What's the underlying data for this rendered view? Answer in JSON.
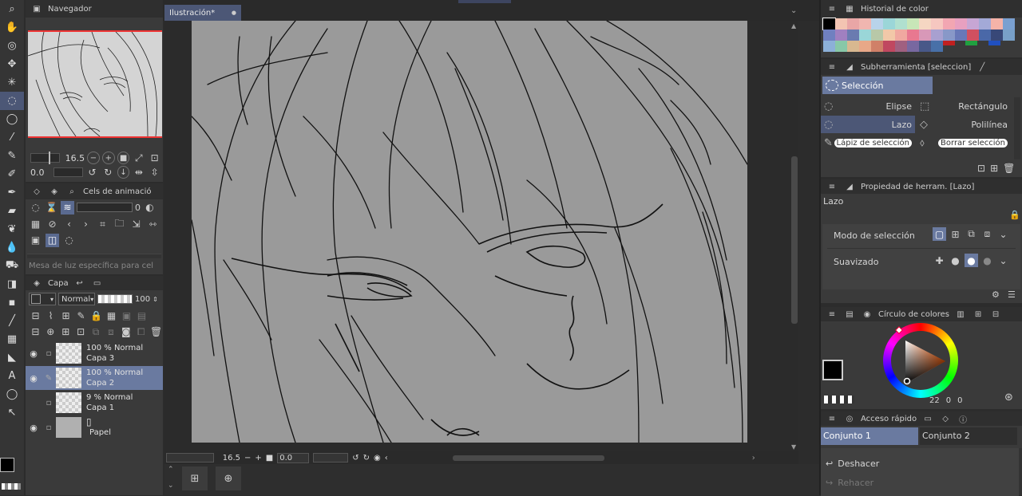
{
  "navigator": {
    "title": "Navegador",
    "zoom": "16.5",
    "rotation": "0.0"
  },
  "document_tab": {
    "label": "Ilustración*",
    "dot": "●"
  },
  "tools": [
    {
      "name": "zoom-tool",
      "icon": "⌕"
    },
    {
      "name": "hand-tool",
      "icon": "✋"
    },
    {
      "name": "rotate-tool",
      "icon": "◎"
    },
    {
      "name": "move-tool",
      "icon": "✥"
    },
    {
      "name": "auto-select-tool",
      "icon": "✳"
    },
    {
      "name": "lasso-tool",
      "icon": "◌"
    },
    {
      "name": "selection-tool",
      "icon": "◯"
    },
    {
      "name": "eyedropper-tool",
      "icon": "⁄"
    },
    {
      "name": "pen-tool",
      "icon": "✎"
    },
    {
      "name": "pencil-tool",
      "icon": "✐"
    },
    {
      "name": "brush-tool",
      "icon": "✒"
    },
    {
      "name": "eraser-tool",
      "icon": "▰"
    },
    {
      "name": "decoration-tool",
      "icon": "❦"
    },
    {
      "name": "blend-tool",
      "icon": "💧"
    },
    {
      "name": "fill-tool",
      "icon": "⛟"
    },
    {
      "name": "gradient-tool",
      "icon": "◨"
    },
    {
      "name": "shape-tool",
      "icon": "▪"
    },
    {
      "name": "line-tool",
      "icon": "╱"
    },
    {
      "name": "frame-tool",
      "icon": "▦"
    },
    {
      "name": "vector-tool",
      "icon": "◣"
    },
    {
      "name": "text-tool",
      "icon": "A"
    },
    {
      "name": "balloon-tool",
      "icon": "◯"
    },
    {
      "name": "correct-line-tool",
      "icon": "↖"
    }
  ],
  "animation_panel": {
    "title": "Cels de animació",
    "value": "0",
    "lightbox_label": "Mesa de luz específica para cel"
  },
  "layer_panel": {
    "tab": "Capa",
    "blend_mode": "Normal",
    "opacity": "100",
    "layers": [
      {
        "line1": "100 % Normal",
        "line2": "Capa 3",
        "selected": false
      },
      {
        "line1": "100 % Normal",
        "line2": "Capa 2",
        "selected": true
      },
      {
        "line1": "9 % Normal",
        "line2": "Capa 1",
        "selected": false
      },
      {
        "line1": "",
        "line2": "Papel",
        "selected": false
      }
    ]
  },
  "canvas_bottom": {
    "zoom": "16.5",
    "rotation": "0.0"
  },
  "color_history": {
    "title": "Historial de color",
    "swatches": [
      "#000000",
      "#f3c4b2",
      "#e9a6a6",
      "#f0b6b0",
      "#b8d3ea",
      "#9bd6d8",
      "#b0e0cf",
      "#c8e6b8",
      "#f5d6c2",
      "#f6c7c0",
      "#f2a6b2",
      "#e8a0c0",
      "#c7a6d4",
      "#a3a9d7",
      "#f5b3a8",
      "#7aa0d0",
      "#7080c0",
      "#a080c0",
      "#6a7bb0",
      "#9ad6d8",
      "#b8c8a8",
      "#f2c8a8",
      "#f0a8a0",
      "#e87890",
      "#d898b8",
      "#a8a0d0",
      "#8898c8",
      "#6878b8",
      "#d05060",
      "#4a68a8",
      "#384878",
      "#78a0c8",
      "#8cb0d8",
      "#88c8a8",
      "#d8b890",
      "#e8a888",
      "#d08068",
      "#c04860",
      "#a06080",
      "#7868a0",
      "#485888",
      "#4870a8",
      "#c02020",
      "#20a040",
      "#2050c0"
    ]
  },
  "subtool": {
    "title": "Subherramienta [seleccion]",
    "group": "Selección",
    "items": [
      {
        "label": "Elipse",
        "icon": "◌"
      },
      {
        "label": "Rectángulo",
        "icon": "⬚"
      },
      {
        "label": "Lazo",
        "icon": "◌",
        "selected": true
      },
      {
        "label": "Polilínea",
        "icon": "◇"
      },
      {
        "label": "Lápiz de selección",
        "icon": "✎"
      },
      {
        "label": "Borrar selección",
        "icon": "⬨"
      }
    ]
  },
  "tool_property": {
    "title": "Propiedad de herram. [Lazo]",
    "name": "Lazo",
    "selection_mode_label": "Modo de selección",
    "antialias_label": "Suavizado"
  },
  "color_wheel": {
    "title": "Círculo de colores",
    "readout_h": "22",
    "readout_s": "0",
    "readout_v": "0",
    "main_color": "#000000",
    "sub_color": "#1a1a1a"
  },
  "quick_access": {
    "title": "Acceso rápido",
    "sets": [
      "Conjunto 1",
      "Conjunto 2"
    ],
    "items": [
      "Deshacer",
      "Rehacer"
    ]
  }
}
